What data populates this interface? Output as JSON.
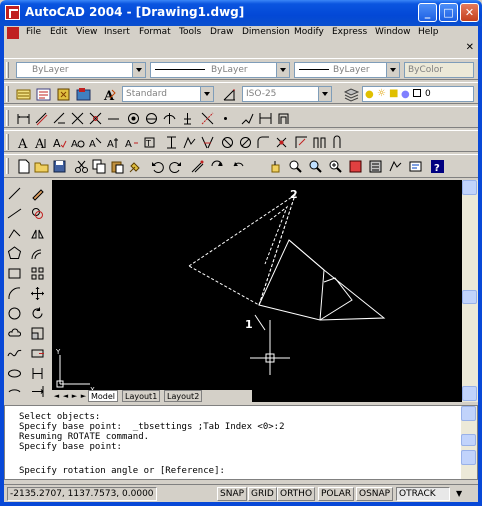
{
  "window": {
    "title": "AutoCAD 2004 - [Drawing1.dwg]",
    "min": "_",
    "max": "□",
    "close": "✕"
  },
  "menu": {
    "items": [
      "File",
      "Edit",
      "View",
      "Insert",
      "Format",
      "Tools",
      "Draw",
      "Dimension",
      "Modify",
      "Express",
      "Window",
      "Help"
    ],
    "close": "✕"
  },
  "properties": {
    "layer_color": "ByLayer",
    "linetype": "ByLayer",
    "lineweight": "ByLayer",
    "plot_style": "ByColor"
  },
  "styles": {
    "text_style": "Standard",
    "dim_style": "ISO-25",
    "layer_name": "0"
  },
  "tabs": {
    "model": "Model",
    "layout1": "Layout1",
    "layout2": "Layout2"
  },
  "drawing": {
    "point1_label": "1",
    "point2_label": "2",
    "ucs_y": "Y",
    "ucs_x": "X"
  },
  "command": {
    "lines": [
      "Select objects:",
      "Specify base point:  _tbsettings ;Tab Index <0>:2",
      "Resuming ROTATE command.",
      "Specify base point:",
      "",
      "Specify rotation angle or [Reference]:"
    ]
  },
  "status": {
    "coords": "-2135.2707, 1137.7573, 0.0000",
    "buttons": [
      "SNAP",
      "GRID",
      "ORTHO",
      "POLAR",
      "OSNAP",
      "OTRACK"
    ]
  }
}
